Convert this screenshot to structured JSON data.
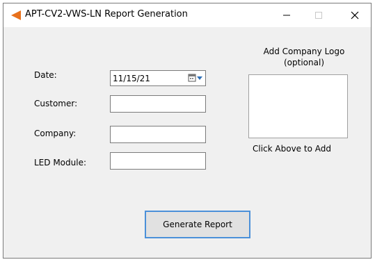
{
  "window": {
    "title": "APT-CV2-VWS-LN Report Generation",
    "icon": "orange-arrow-icon",
    "accent_color": "#e8711c"
  },
  "titlebar_buttons": {
    "minimize": "—",
    "maximize": "☐",
    "close": "✕"
  },
  "form": {
    "date_label": "Date:",
    "date_value": "11/15/21",
    "customer_label": "Customer:",
    "customer_value": "",
    "company_label": "Company:",
    "company_value": "",
    "led_module_label": "LED Module:",
    "led_module_value": ""
  },
  "logo": {
    "title_line1": "Add Company Logo",
    "title_line2": "(optional)",
    "hint": "Click Above to Add"
  },
  "actions": {
    "generate_label": "Generate Report",
    "focus_color": "#4a90d9"
  }
}
